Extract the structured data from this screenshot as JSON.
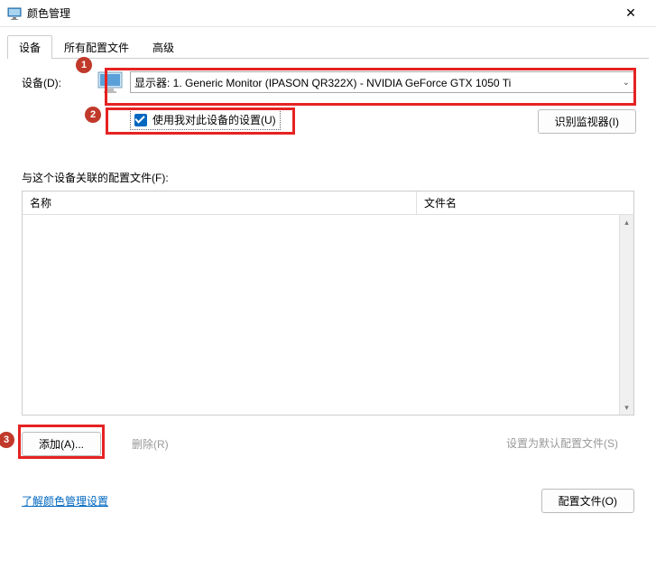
{
  "window": {
    "title": "颜色管理",
    "close": "✕"
  },
  "tabs": {
    "device": "设备",
    "profiles": "所有配置文件",
    "advanced": "高级"
  },
  "device": {
    "label": "设备(D):",
    "selected": "显示器: 1. Generic Monitor (IPASON QR322X) - NVIDIA GeForce GTX 1050 Ti",
    "use_settings": "使用我对此设备的设置(U)",
    "identify": "识别监视器(I)"
  },
  "profiles": {
    "label": "与这个设备关联的配置文件(F):",
    "col_name": "名称",
    "col_file": "文件名"
  },
  "buttons": {
    "add": "添加(A)...",
    "remove": "删除(R)",
    "set_default": "设置为默认配置文件(S)",
    "profile_file": "配置文件(O)"
  },
  "link": "了解颜色管理设置",
  "badges": {
    "b1": "1",
    "b2": "2",
    "b3": "3"
  }
}
